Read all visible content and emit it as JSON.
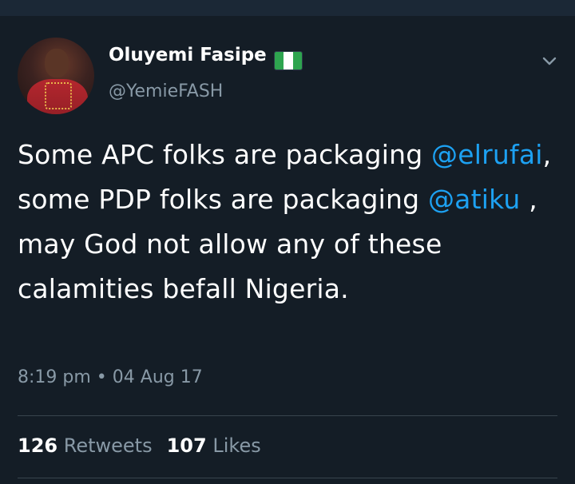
{
  "tweet": {
    "display_name": "Oluyemi Fasipe",
    "handle": "@YemieFASH",
    "flag_icon": "nigeria-flag-icon",
    "text": {
      "part1": "Some APC folks are packaging ",
      "mention1": "@elrufai",
      "part2": ", some PDP folks are packaging ",
      "mention2": "@atiku",
      "part3": " , may God not allow any of these calamities befall Nigeria."
    },
    "time": "8:19 pm",
    "separator": "•",
    "date": "04 Aug 17",
    "retweets_count": "126",
    "retweets_label": "Retweets",
    "likes_count": "107",
    "likes_label": "Likes"
  },
  "colors": {
    "background": "#141d26",
    "mention": "#1da1f2",
    "secondary_text": "#8899a6",
    "divider": "#38444d"
  }
}
